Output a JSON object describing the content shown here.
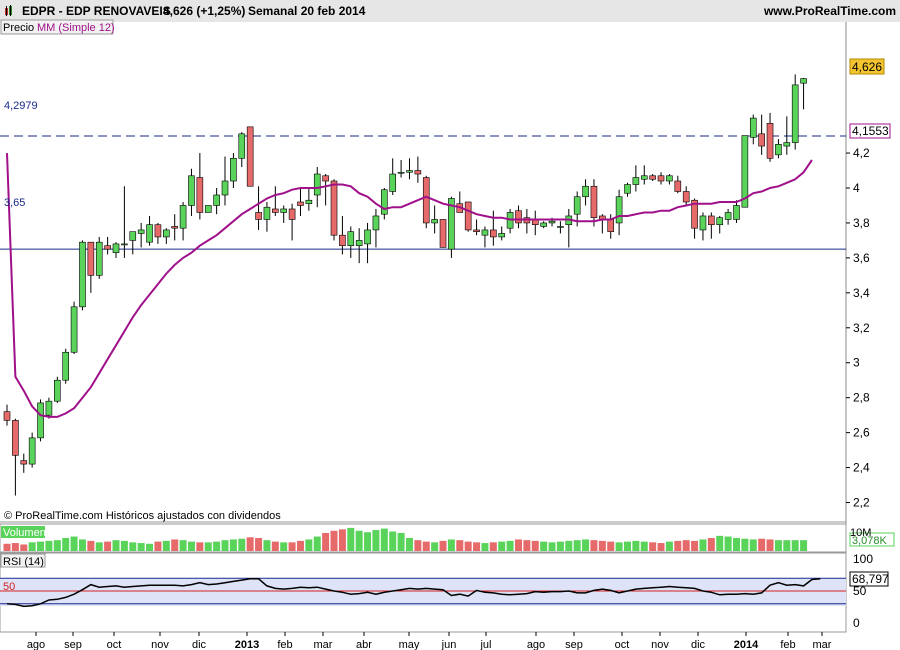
{
  "header": {
    "symbol": "EDPR - EDP RENOVAVEIS",
    "quote": "4,626 (+1,25%)",
    "period": "Semanal  20 feb 2014",
    "site": "www.ProRealTime.com"
  },
  "legend": {
    "price_label": "Precio",
    "ma_label": "MM (Simple 12)",
    "volume_label": "Volumen",
    "rsi_label": "RSI (14)"
  },
  "footer_note": "© ProRealTime.com Históricos ajustados con dividendos",
  "colors": {
    "up": "#5ad35a",
    "down": "#e66a6a",
    "ma": "#a0108a",
    "rsi_line": "#000000",
    "rsi_band": "#dfe3f8",
    "rsi_mid": "#d02020",
    "hline": "#1a2a8a",
    "price_badge": "#f4c430"
  },
  "chart_data": [
    {
      "type": "candlestick",
      "title": "EDPR - EDP RENOVAVEIS",
      "ylim": [
        2.1,
        4.95
      ],
      "y_ticks": [
        "2,2",
        "2,4",
        "2,6",
        "2,8",
        "3",
        "3,2",
        "3,4",
        "3,6",
        "3,8",
        "4",
        "4,2"
      ],
      "x_ticks": [
        "ago",
        "sep",
        "oct",
        "nov",
        "dic",
        "2013",
        "feb",
        "mar",
        "abr",
        "may",
        "jun",
        "jul",
        "ago",
        "sep",
        "oct",
        "nov",
        "dic",
        "2014",
        "feb",
        "mar"
      ],
      "last_price": "4,626",
      "ma_last": "4,1553",
      "ma_name": "MM (Simple 12)",
      "horizontal_lines": [
        {
          "label": "4,2979",
          "value": 4.2979,
          "style": "dashed"
        },
        {
          "label": "3,65",
          "value": 3.65,
          "style": "solid"
        }
      ],
      "candles": [
        [
          2.72,
          2.76,
          2.64,
          2.67
        ],
        [
          2.67,
          2.68,
          2.24,
          2.47
        ],
        [
          2.44,
          2.48,
          2.37,
          2.42
        ],
        [
          2.42,
          2.6,
          2.4,
          2.57
        ],
        [
          2.57,
          2.79,
          2.55,
          2.77
        ],
        [
          2.7,
          2.8,
          2.68,
          2.78
        ],
        [
          2.78,
          2.92,
          2.77,
          2.9
        ],
        [
          2.9,
          3.08,
          2.88,
          3.06
        ],
        [
          3.06,
          3.35,
          3.05,
          3.32
        ],
        [
          3.32,
          3.7,
          3.3,
          3.69
        ],
        [
          3.69,
          3.69,
          3.4,
          3.5
        ],
        [
          3.5,
          3.72,
          3.48,
          3.69
        ],
        [
          3.67,
          3.72,
          3.62,
          3.65
        ],
        [
          3.63,
          3.69,
          3.6,
          3.68
        ],
        [
          3.68,
          4.01,
          3.6,
          3.68
        ],
        [
          3.7,
          3.75,
          3.62,
          3.75
        ],
        [
          3.74,
          3.8,
          3.66,
          3.76
        ],
        [
          3.69,
          3.84,
          3.67,
          3.79
        ],
        [
          3.79,
          3.8,
          3.68,
          3.72
        ],
        [
          3.72,
          3.77,
          3.68,
          3.76
        ],
        [
          3.78,
          3.85,
          3.7,
          3.77
        ],
        [
          3.77,
          3.92,
          3.7,
          3.9
        ],
        [
          3.9,
          4.11,
          3.84,
          4.07
        ],
        [
          4.06,
          4.2,
          3.82,
          3.86
        ],
        [
          3.86,
          3.9,
          3.86,
          3.9
        ],
        [
          3.9,
          4.0,
          3.85,
          3.96
        ],
        [
          3.96,
          4.18,
          3.9,
          4.04
        ],
        [
          4.04,
          4.2,
          4.0,
          4.17
        ],
        [
          4.17,
          4.32,
          4.12,
          4.31
        ],
        [
          4.35,
          4.35,
          4.02,
          4.01
        ],
        [
          3.86,
          4.01,
          3.76,
          3.82
        ],
        [
          3.82,
          3.92,
          3.75,
          3.89
        ],
        [
          3.88,
          4.01,
          3.84,
          3.86
        ],
        [
          3.86,
          3.9,
          3.8,
          3.88
        ],
        [
          3.88,
          3.91,
          3.7,
          3.82
        ],
        [
          3.92,
          4.0,
          3.84,
          3.9
        ],
        [
          3.91,
          4.0,
          3.87,
          3.93
        ],
        [
          3.96,
          4.12,
          3.89,
          4.08
        ],
        [
          4.07,
          4.08,
          3.9,
          4.04
        ],
        [
          4.04,
          4.05,
          3.7,
          3.73
        ],
        [
          3.73,
          3.84,
          3.62,
          3.67
        ],
        [
          3.67,
          3.78,
          3.6,
          3.75
        ],
        [
          3.67,
          3.77,
          3.57,
          3.7
        ],
        [
          3.68,
          3.8,
          3.57,
          3.76
        ],
        [
          3.76,
          3.88,
          3.66,
          3.84
        ],
        [
          3.85,
          4.0,
          3.82,
          3.99
        ],
        [
          3.98,
          4.17,
          3.96,
          4.08
        ],
        [
          4.09,
          4.16,
          4.06,
          4.09
        ],
        [
          4.09,
          4.17,
          4.05,
          4.1
        ],
        [
          4.1,
          4.18,
          4.03,
          4.08
        ],
        [
          4.06,
          4.07,
          3.77,
          3.8
        ],
        [
          3.8,
          3.9,
          3.74,
          3.82
        ],
        [
          3.82,
          3.82,
          3.66,
          3.66
        ],
        [
          3.65,
          3.95,
          3.6,
          3.94
        ],
        [
          3.91,
          3.98,
          3.86,
          3.86
        ],
        [
          3.92,
          3.92,
          3.75,
          3.76
        ],
        [
          3.76,
          3.82,
          3.73,
          3.75
        ],
        [
          3.73,
          3.78,
          3.66,
          3.76
        ],
        [
          3.76,
          3.87,
          3.67,
          3.72
        ],
        [
          3.72,
          3.78,
          3.7,
          3.74
        ],
        [
          3.77,
          3.88,
          3.74,
          3.86
        ],
        [
          3.87,
          3.9,
          3.77,
          3.8
        ],
        [
          3.83,
          3.88,
          3.74,
          3.8
        ],
        [
          3.82,
          3.87,
          3.73,
          3.79
        ],
        [
          3.78,
          3.81,
          3.77,
          3.8
        ],
        [
          3.8,
          3.83,
          3.78,
          3.81
        ],
        [
          3.78,
          3.81,
          3.74,
          3.78
        ],
        [
          3.79,
          3.88,
          3.66,
          3.84
        ],
        [
          3.85,
          3.98,
          3.78,
          3.95
        ],
        [
          3.95,
          4.05,
          3.9,
          4.01
        ],
        [
          4.01,
          4.05,
          3.78,
          3.83
        ],
        [
          3.84,
          3.85,
          3.74,
          3.82
        ],
        [
          3.82,
          3.85,
          3.71,
          3.75
        ],
        [
          3.8,
          3.99,
          3.73,
          3.95
        ],
        [
          3.97,
          4.03,
          3.95,
          4.02
        ],
        [
          4.02,
          4.13,
          3.98,
          4.06
        ],
        [
          4.05,
          4.13,
          4.02,
          4.07
        ],
        [
          4.07,
          4.08,
          4.04,
          4.05
        ],
        [
          4.07,
          4.09,
          4.02,
          4.04
        ],
        [
          4.04,
          4.08,
          4.02,
          4.07
        ],
        [
          4.04,
          4.07,
          3.97,
          3.98
        ],
        [
          3.98,
          4.01,
          3.9,
          3.92
        ],
        [
          3.93,
          3.94,
          3.71,
          3.77
        ],
        [
          3.76,
          3.86,
          3.7,
          3.84
        ],
        [
          3.84,
          3.86,
          3.71,
          3.79
        ],
        [
          3.79,
          3.84,
          3.74,
          3.83
        ],
        [
          3.82,
          3.88,
          3.79,
          3.86
        ],
        [
          3.82,
          3.93,
          3.8,
          3.9
        ],
        [
          3.89,
          4.3,
          3.89,
          4.3
        ],
        [
          4.29,
          4.42,
          4.25,
          4.4
        ],
        [
          4.31,
          4.42,
          4.19,
          4.24
        ],
        [
          4.37,
          4.43,
          4.15,
          4.17
        ],
        [
          4.19,
          4.28,
          4.17,
          4.25
        ],
        [
          4.24,
          4.41,
          4.19,
          4.26
        ],
        [
          4.26,
          4.65,
          4.22,
          4.59
        ],
        [
          4.6,
          4.63,
          4.45,
          4.626
        ]
      ],
      "ma_values": [
        4.2,
        2.92,
        2.84,
        2.75,
        2.7,
        2.69,
        2.69,
        2.71,
        2.74,
        2.8,
        2.86,
        2.94,
        3.02,
        3.1,
        3.18,
        3.26,
        3.33,
        3.39,
        3.45,
        3.51,
        3.56,
        3.6,
        3.63,
        3.67,
        3.7,
        3.73,
        3.77,
        3.81,
        3.85,
        3.88,
        3.91,
        3.94,
        3.96,
        3.97,
        3.99,
        4.0,
        4.0,
        4.0,
        4.01,
        4.02,
        4.02,
        4.01,
        3.97,
        3.95,
        3.91,
        3.88,
        3.89,
        3.89,
        3.91,
        3.93,
        3.95,
        3.93,
        3.91,
        3.9,
        3.89,
        3.87,
        3.85,
        3.84,
        3.83,
        3.83,
        3.82,
        3.82,
        3.82,
        3.82,
        3.82,
        3.82,
        3.82,
        3.82,
        3.81,
        3.81,
        3.81,
        3.82,
        3.82,
        3.84,
        3.84,
        3.85,
        3.86,
        3.86,
        3.87,
        3.87,
        3.89,
        3.9,
        3.91,
        3.91,
        3.91,
        3.92,
        3.92,
        3.92,
        3.94,
        3.97,
        3.98,
        4.0,
        4.01,
        4.03,
        4.05,
        4.09,
        4.16
      ]
    },
    {
      "type": "bar",
      "title": "Volumen",
      "last_value": "3,078K",
      "y_tick": "10M",
      "values": [
        1.0,
        1.1,
        0.9,
        1.2,
        1.3,
        1.4,
        1.5,
        1.8,
        2.0,
        1.6,
        1.4,
        1.2,
        1.3,
        1.5,
        1.4,
        1.2,
        1.1,
        1.0,
        1.3,
        1.4,
        1.6,
        1.5,
        1.3,
        1.2,
        1.2,
        1.3,
        1.5,
        1.6,
        1.7,
        1.9,
        1.8,
        1.5,
        1.3,
        1.2,
        1.2,
        1.4,
        1.6,
        2.0,
        2.5,
        2.8,
        3.0,
        3.2,
        2.8,
        2.6,
        2.9,
        3.1,
        2.7,
        2.5,
        1.8,
        1.5,
        1.3,
        1.2,
        1.4,
        1.6,
        1.5,
        1.3,
        1.2,
        1.1,
        1.2,
        1.3,
        1.4,
        1.6,
        1.5,
        1.4,
        1.3,
        1.2,
        1.3,
        1.4,
        1.5,
        1.6,
        1.5,
        1.4,
        1.3,
        1.2,
        1.3,
        1.4,
        1.3,
        1.2,
        1.1,
        1.3,
        1.4,
        1.5,
        1.4,
        1.6,
        1.8,
        2.1,
        2.0,
        1.8,
        1.7,
        1.6,
        1.7,
        1.6,
        1.5,
        1.5,
        1.5,
        1.5
      ]
    },
    {
      "type": "line",
      "title": "RSI (14)",
      "ylim": [
        0,
        100
      ],
      "y_ticks": [
        "0",
        "50",
        "100"
      ],
      "mid_label": "50",
      "last_value": "68,797",
      "values": [
        30,
        29,
        26,
        27,
        30,
        36,
        37,
        40,
        45,
        52,
        60,
        56,
        57,
        58,
        56,
        57,
        58,
        59,
        59,
        59,
        59,
        58,
        60,
        63,
        60,
        61,
        63,
        65,
        67,
        69,
        69,
        58,
        54,
        53,
        54,
        56,
        55,
        56,
        53,
        50,
        48,
        45,
        46,
        48,
        45,
        48,
        50,
        52,
        54,
        53,
        54,
        53,
        52,
        43,
        45,
        42,
        51,
        48,
        47,
        45,
        44,
        45,
        46,
        49,
        48,
        49,
        49,
        50,
        47,
        47,
        51,
        53,
        51,
        47,
        50,
        53,
        54,
        55,
        56,
        57,
        56,
        55,
        54,
        50,
        48,
        44,
        45,
        45,
        46,
        45,
        47,
        59,
        63,
        59,
        60,
        58,
        68,
        69
      ]
    }
  ]
}
